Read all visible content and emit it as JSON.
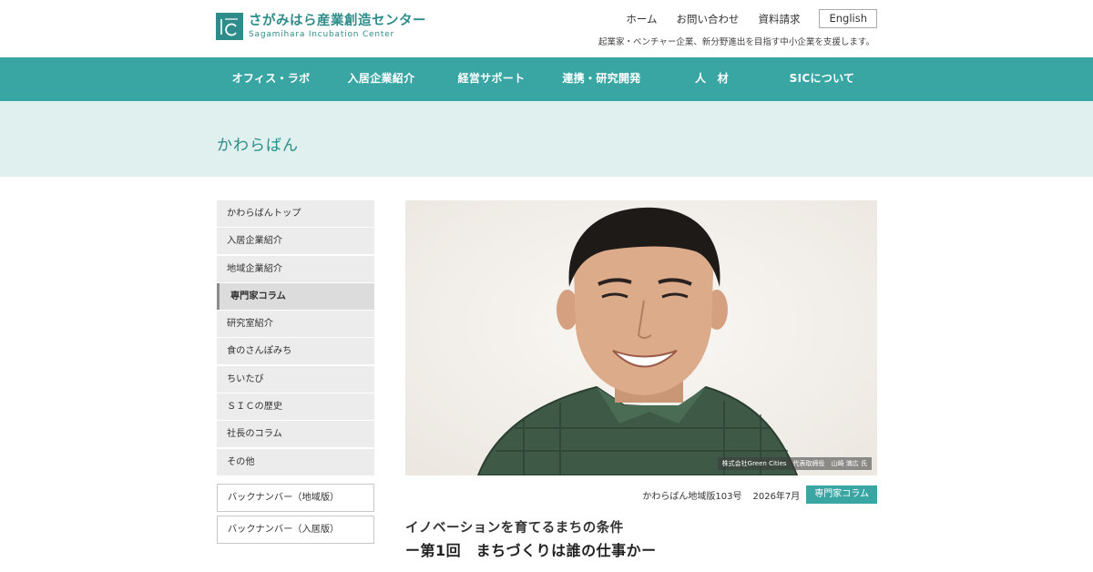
{
  "header": {
    "logo_jp": "さがみはら産業創造センター",
    "logo_en": "Sagamihara Incubation Center",
    "links": [
      "ホーム",
      "お問い合わせ",
      "資料請求"
    ],
    "lang_button": "English",
    "tagline": "起業家・ベンチャー企業、新分野進出を目指す中小企業を支援します。"
  },
  "main_nav": {
    "items": [
      "オフィス・ラボ",
      "入居企業紹介",
      "経営サポート",
      "連携・研究開発",
      "人　材",
      "SICについて"
    ]
  },
  "page_title": "かわらばん",
  "sidebar": {
    "items": [
      {
        "label": "かわらばんトップ"
      },
      {
        "label": "入居企業紹介"
      },
      {
        "label": "地域企業紹介"
      },
      {
        "label": "専門家コラム",
        "active": true
      },
      {
        "label": "研究室紹介"
      },
      {
        "label": "食のさんぽみち"
      },
      {
        "label": "ちいたび"
      },
      {
        "label": "ＳＩＣの歴史"
      },
      {
        "label": "社長のコラム"
      },
      {
        "label": "その他"
      }
    ],
    "backnumbers": [
      "バックナンバー（地域版）",
      "バックナンバー（入居版）"
    ]
  },
  "article": {
    "photo_credit": "株式会社Green Cities　代表取締役　山崎 満広 氏",
    "issue": "かわらばん地域版103号",
    "date": "2026年7月",
    "category": "専門家コラム",
    "title": "イノベーションを育てるまちの条件",
    "subtitle": "ー第1回　まちづくりは誰の仕事かー"
  },
  "colors": {
    "accent": "#3aa6a4",
    "brand": "#2e8c8a",
    "title_band": "#dff0ef"
  }
}
